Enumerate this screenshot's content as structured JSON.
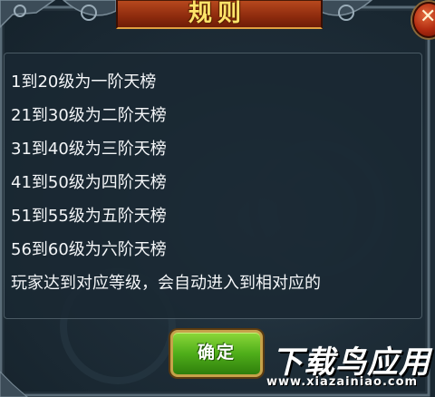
{
  "dialog": {
    "title": "规则",
    "close_label": "✕",
    "rules": [
      "1到20级为一阶天榜",
      "21到30级为二阶天榜",
      "31到40级为三阶天榜",
      "41到50级为四阶天榜",
      "51到55级为五阶天榜",
      "56到60级为六阶天榜",
      "玩家达到对应等级，会自动进入到相对应的"
    ],
    "confirm_label": "确定"
  },
  "watermark": {
    "main": "下载鸟应用",
    "sub": "www.xiazainiao.com"
  },
  "colors": {
    "panel_bg": "#1e2d38",
    "title_text": "#ffe46a",
    "banner": "#b94a1e",
    "confirm_button": "#4fae1a",
    "close_button": "#b02a10",
    "rule_text": "#f4f6f8"
  }
}
